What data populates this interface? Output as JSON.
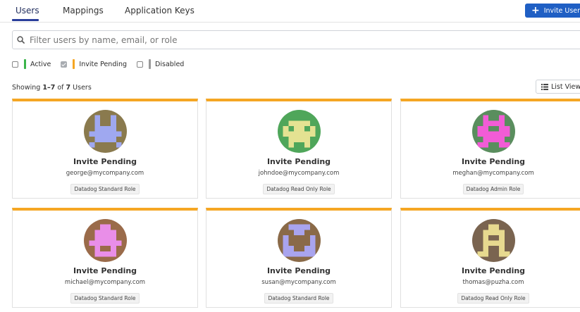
{
  "tabs": [
    {
      "label": "Users"
    },
    {
      "label": "Mappings"
    },
    {
      "label": "Application Keys"
    }
  ],
  "invite_button": {
    "label": "Invite Users",
    "icon": "plus-icon",
    "color": "#1f5fc4"
  },
  "search": {
    "placeholder": "Filter users by name, email, or role",
    "value": ""
  },
  "filters": [
    {
      "label": "Active",
      "checked": false,
      "color": "#3bb54a"
    },
    {
      "label": "Invite Pending",
      "checked": true,
      "color": "#f5a623"
    },
    {
      "label": "Disabled",
      "checked": false,
      "color": "#9a9a9a"
    }
  ],
  "showing": {
    "prefix": "Showing ",
    "range": "1–7",
    "middle": " of ",
    "count": "7",
    "suffix": " Users"
  },
  "list_view": {
    "label": "List View",
    "icon": "list-icon"
  },
  "accent_color": "#f5a623",
  "users": [
    {
      "status": "Invite Pending",
      "email": "george@mycompany.com",
      "role": "Datadog Standard Role",
      "avatar_bg": "#8a7a4e",
      "avatar_fg": "#9fa8f0",
      "avatar_icon": "pixel-avatar-icon"
    },
    {
      "status": "Invite Pending",
      "email": "johndoe@mycompany.com",
      "role": "Datadog Read Only Role",
      "avatar_bg": "#4fa65a",
      "avatar_fg": "#e4e292",
      "avatar_icon": "pixel-avatar-icon"
    },
    {
      "status": "Invite Pending",
      "email": "meghan@mycompany.com",
      "role": "Datadog Admin Role",
      "avatar_bg": "#5a8e5e",
      "avatar_fg": "#f25cd6",
      "avatar_icon": "pixel-avatar-icon"
    },
    {
      "status": "Invite Pending",
      "email": "michael@mycompany.com",
      "role": "Datadog Standard Role",
      "avatar_bg": "#9a6b4a",
      "avatar_fg": "#e98ee8",
      "avatar_icon": "pixel-avatar-icon"
    },
    {
      "status": "Invite Pending",
      "email": "susan@mycompany.com",
      "role": "Datadog Standard Role",
      "avatar_bg": "#8a6a48",
      "avatar_fg": "#a9a4ee",
      "avatar_icon": "pixel-avatar-icon"
    },
    {
      "status": "Invite Pending",
      "email": "thomas@puzha.com",
      "role": "Datadog Read Only Role",
      "avatar_bg": "#7a6450",
      "avatar_fg": "#e7d98f",
      "avatar_icon": "pixel-avatar-icon"
    }
  ]
}
